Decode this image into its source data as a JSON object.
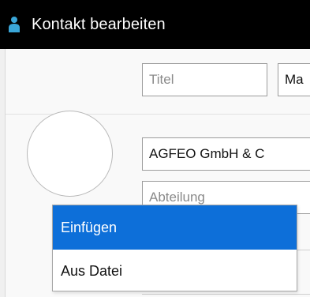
{
  "window": {
    "title": "Kontakt bearbeiten",
    "icon": "person-icon"
  },
  "form": {
    "title_placeholder": "Titel",
    "firstname_value": "Ma",
    "company_value": "AGFEO GmbH & C",
    "department_placeholder": "Abteilung"
  },
  "context_menu": {
    "items": [
      {
        "label": "Einfügen",
        "selected": true
      },
      {
        "label": "Aus Datei",
        "selected": false
      }
    ]
  },
  "colors": {
    "titlebar_bg": "#000000",
    "accent": "#0d6fd9",
    "icon_color": "#3aa6d8"
  }
}
